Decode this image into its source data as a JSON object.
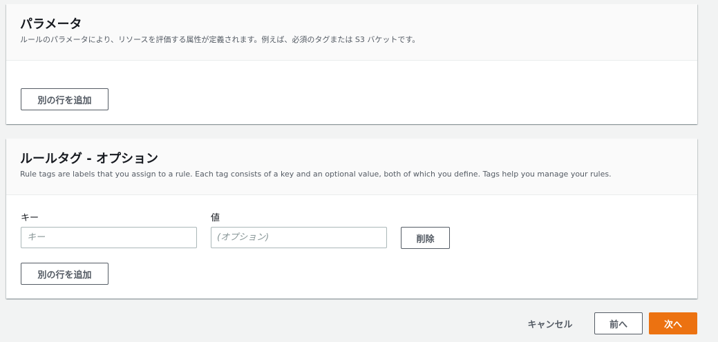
{
  "parameters": {
    "title": "パラメータ",
    "description": "ルールのパラメータにより、リソースを評価する属性が定義されます。例えば、必須のタグまたは S3 バケットです。",
    "add_row_label": "別の行を追加"
  },
  "rule_tags": {
    "title": "ルールタグ - オプション",
    "description": "Rule tags are labels that you assign to a rule. Each tag consists of a key and an optional value, both of which you define. Tags help you manage your rules.",
    "key_label": "キー",
    "key_placeholder": "キー",
    "value_label": "値",
    "value_placeholder": "(オプション)",
    "remove_label": "削除",
    "add_row_label": "別の行を追加"
  },
  "footer": {
    "cancel_label": "キャンセル",
    "previous_label": "前へ",
    "next_label": "次へ"
  },
  "colors": {
    "primary": "#ec7211",
    "background": "#f2f3f3"
  }
}
